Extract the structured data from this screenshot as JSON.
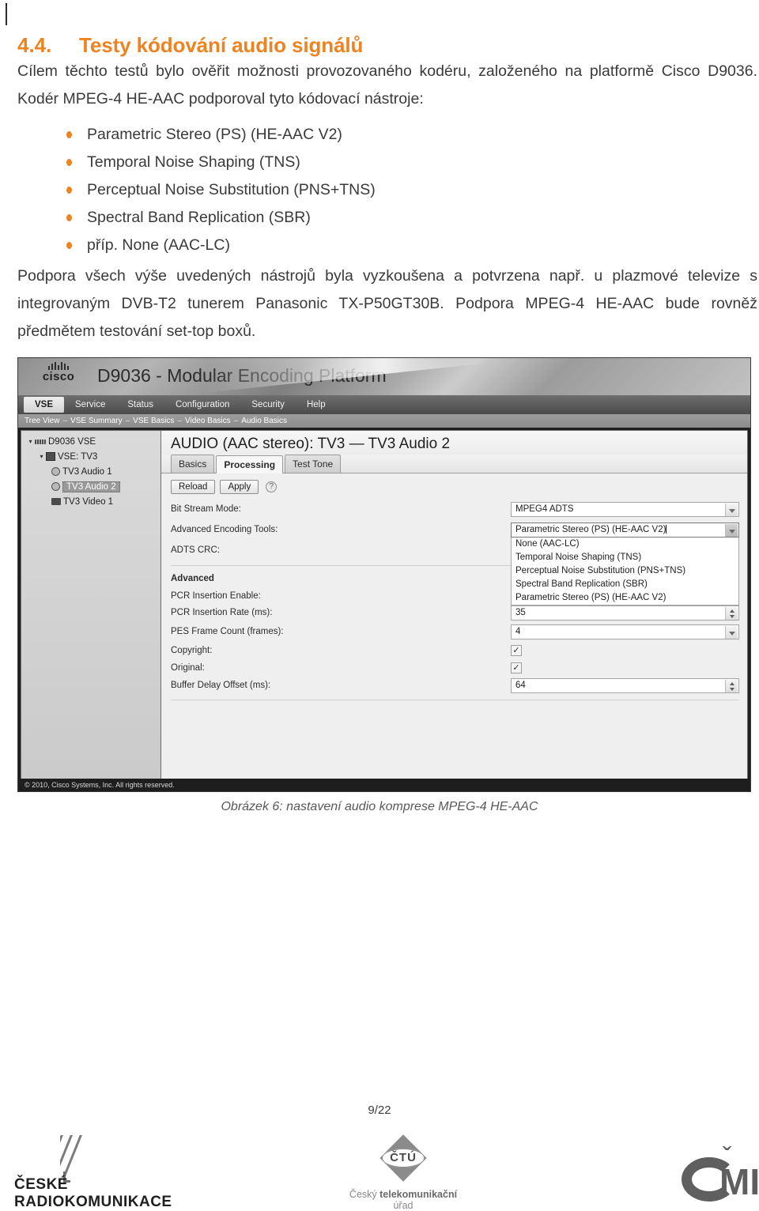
{
  "heading": {
    "number": "4.4.",
    "text": "Testy kódování audio signálů"
  },
  "paragraphs": {
    "intro": "Cílem těchto testů bylo ověřit možnosti provozovaného kodéru, založeného na platformě Cisco D9036. Kodér MPEG-4 HE-AAC podporoval tyto kódovací nástroje:",
    "after": "Podpora všech výše uvedených nástrojů byla vyzkoušena a potvrzena např. u plazmové televize s integrovaným DVB-T2 tunerem Panasonic TX-P50GT30B. Podpora MPEG-4 HE-AAC  bude rovněž předmětem testování set-top boxů."
  },
  "bullets": [
    "Parametric Stereo (PS) (HE-AAC V2)",
    "Temporal Noise Shaping (TNS)",
    "Perceptual Noise Substitution (PNS+TNS)",
    "Spectral Band Replication (SBR)",
    "příp. None (AAC-LC)"
  ],
  "screenshot": {
    "brand": "cisco",
    "title": "D9036 - Modular Encoding Platform",
    "menu": [
      {
        "label": "VSE",
        "active": true
      },
      {
        "label": "Service",
        "active": false
      },
      {
        "label": "Status",
        "active": false
      },
      {
        "label": "Configuration",
        "active": false
      },
      {
        "label": "Security",
        "active": false
      },
      {
        "label": "Help",
        "active": false
      }
    ],
    "breadcrumbs": [
      "Tree View",
      "VSE Summary",
      "VSE Basics",
      "Video Basics",
      "Audio Basics"
    ],
    "tree": [
      {
        "label": "D9036 VSE",
        "icon": "chassis-icon",
        "indent": 1,
        "twisty": "▾",
        "selected": false
      },
      {
        "label": "VSE: TV3",
        "icon": "vse-icon",
        "indent": 2,
        "twisty": "▾",
        "selected": false
      },
      {
        "label": "TV3 Audio 1",
        "icon": "audio-icon",
        "indent": 3,
        "twisty": "",
        "selected": false
      },
      {
        "label": "TV3 Audio 2",
        "icon": "audio-icon",
        "indent": 3,
        "twisty": "",
        "selected": true
      },
      {
        "label": "TV3 Video 1",
        "icon": "video-icon",
        "indent": 3,
        "twisty": "",
        "selected": false
      }
    ],
    "pane_title": "AUDIO (AAC stereo): TV3 — TV3 Audio 2",
    "tabs": [
      {
        "label": "Basics",
        "active": false
      },
      {
        "label": "Processing",
        "active": true
      },
      {
        "label": "Test Tone",
        "active": false
      }
    ],
    "buttons": {
      "reload": "Reload",
      "apply": "Apply",
      "help": "?"
    },
    "form": {
      "bit_stream_mode_label": "Bit Stream Mode:",
      "bit_stream_mode_value": "MPEG4 ADTS",
      "advanced_encoding_tools_label": "Advanced Encoding Tools:",
      "advanced_encoding_tools_value": "Parametric Stereo (PS) (HE-AAC V2)",
      "advanced_encoding_tools_options": [
        "None (AAC-LC)",
        "Temporal Noise Shaping (TNS)",
        "Perceptual Noise Substitution (PNS+TNS)",
        "Spectral Band Replication (SBR)",
        "Parametric Stereo (PS) (HE-AAC V2)"
      ],
      "adts_crc_label": "ADTS CRC:",
      "advanced_section_label": "Advanced",
      "pcr_insertion_enable_label": "PCR Insertion Enable:",
      "pcr_insertion_rate_label": "PCR Insertion Rate (ms):",
      "pcr_insertion_rate_value": "35",
      "pes_frame_count_label": "PES Frame Count (frames):",
      "pes_frame_count_value": "4",
      "copyright_label": "Copyright:",
      "copyright_checked": "✓",
      "original_label": "Original:",
      "original_checked": "✓",
      "buffer_delay_offset_label": "Buffer Delay Offset (ms):",
      "buffer_delay_offset_value": "64"
    },
    "footer": "© 2010, Cisco Systems, Inc. All rights reserved."
  },
  "caption": "Obrázek 6: nastavení audio komprese MPEG-4 HE-AAC",
  "page_number": "9/22",
  "logos": {
    "cra_line1": "ČESKÉ",
    "cra_line2": "RADIOKOMUNIKACE",
    "ctu_abbr": "ČTÚ",
    "ctu_name_1": "Český ",
    "ctu_name_2": "telekomunikační ",
    "ctu_name_3": "úřad",
    "cmi_letters": "MI",
    "cmi_caron": "ˇ"
  },
  "colors": {
    "heading_orange": "#EE8322",
    "bullet_orange": "#EE8322",
    "body_text": "#3a3a3a"
  }
}
